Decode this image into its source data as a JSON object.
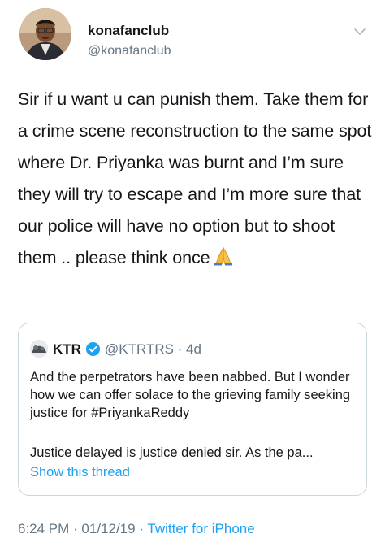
{
  "author": {
    "display_name": "konafanclub",
    "handle": "@konafanclub"
  },
  "tweet": {
    "text": "Sir if u want u can punish them. Take them for a crime scene reconstruction to the same spot where Dr. Priyanka was burnt and I’m sure they will try to escape and I’m more sure that our police will have no option but to shoot them .. please think once",
    "emoji_icon": "folded-hands-icon"
  },
  "quoted_tweet": {
    "name": "KTR",
    "verified_icon": "verified-badge-icon",
    "handle_time": "@KTRTRS · 4d",
    "text": "And the perpetrators have been nabbed. But I wonder how we can offer solace to the grieving family seeking justice for #PriyankaReddy",
    "text2": "Justice delayed is justice denied sir. As the pa...",
    "show_thread": "Show this thread"
  },
  "meta": {
    "timestamp": "6:24 PM · 01/12/19 · ",
    "source": "Twitter for iPhone"
  },
  "colors": {
    "link": "#1da1f2",
    "secondary": "#657786",
    "border": "#ccd6dd",
    "text": "#14171a"
  }
}
